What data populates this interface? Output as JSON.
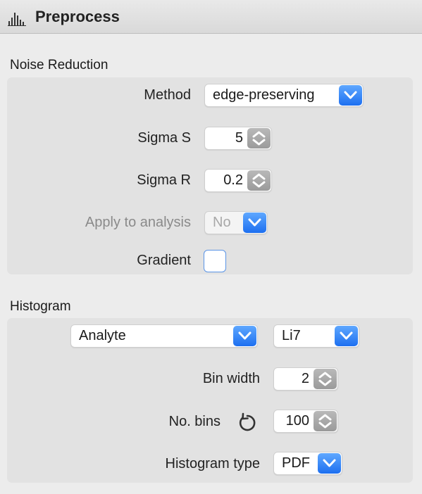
{
  "panel": {
    "title": "Preprocess",
    "icon": "histogram-bars-icon"
  },
  "noise_reduction": {
    "section_label": "Noise Reduction",
    "method": {
      "label": "Method",
      "value": "edge-preserving"
    },
    "sigma_s": {
      "label": "Sigma S",
      "value": "5"
    },
    "sigma_r": {
      "label": "Sigma R",
      "value": "0.2"
    },
    "apply_to_analysis": {
      "label": "Apply to analysis",
      "value": "No",
      "enabled": false
    },
    "gradient": {
      "label": "Gradient",
      "checked": false
    }
  },
  "histogram": {
    "section_label": "Histogram",
    "field_select": {
      "value": "Analyte"
    },
    "analyte_select": {
      "value": "Li7"
    },
    "bin_width": {
      "label": "Bin width",
      "value": "2"
    },
    "num_bins": {
      "label": "No. bins",
      "value": "100",
      "reset_icon": "reset-icon"
    },
    "histogram_type": {
      "label": "Histogram type",
      "value": "PDF"
    }
  },
  "colors": {
    "accent": "#2f80f5",
    "panel_bg": "#e2e2e2",
    "window_bg": "#ececec"
  }
}
